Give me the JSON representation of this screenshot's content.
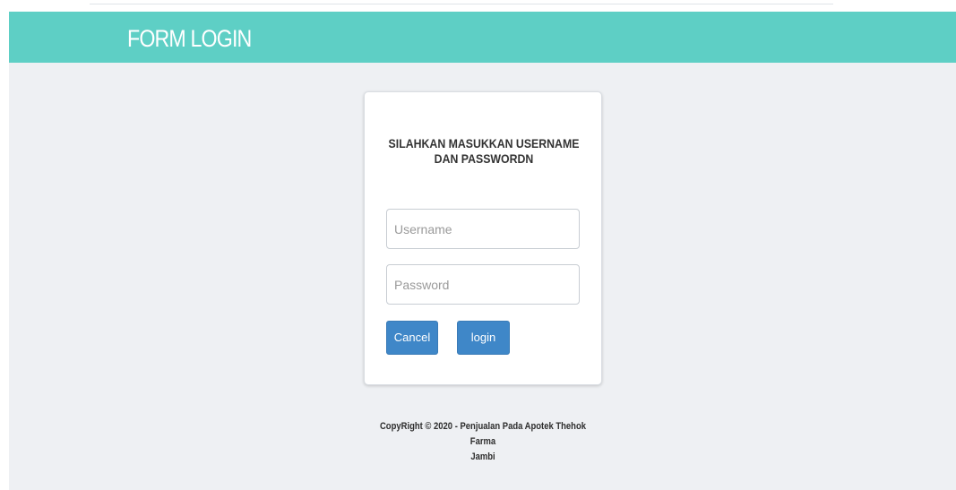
{
  "header": {
    "title": "FORM LOGIN"
  },
  "login_card": {
    "heading_line1": "SILAHKAN MASUKKAN USERNAME",
    "heading_line2": "DAN PASSWORDN",
    "username_placeholder": "Username",
    "username_value": "",
    "password_placeholder": "Password",
    "password_value": "",
    "cancel_label": "Cancel",
    "login_label": "login"
  },
  "footer": {
    "copyright_line1": "CopyRight © 2020 - Penjualan Pada Apotek Thehok Farma",
    "copyright_line2": "Jambi"
  },
  "colors": {
    "header_bg": "#5ecfc5",
    "page_bg": "#eef0f3",
    "button_bg": "#3f87c8"
  }
}
